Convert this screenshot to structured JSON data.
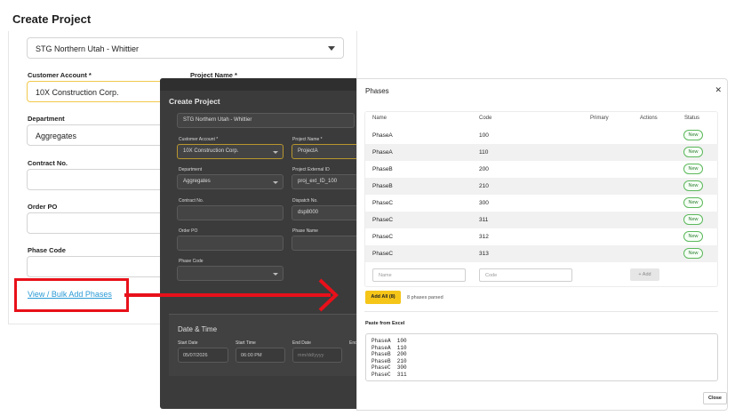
{
  "page_title": "Create Project",
  "form": {
    "company_value": "STG Northern Utah - Whittier",
    "customer_account_label": "Customer Account *",
    "customer_account_value": "10X Construction Corp.",
    "project_name_label": "Project Name *",
    "department_label": "Department",
    "department_value": "Aggregates",
    "contract_no_label": "Contract No.",
    "order_po_label": "Order PO",
    "phase_code_label": "Phase Code",
    "bulk_link": "View / Bulk Add Phases"
  },
  "overlay": {
    "title": "Create Project",
    "company_value": "STG Northern Utah - Whittier",
    "customer_account_label": "Customer Account *",
    "customer_account_value": "10X Construction Corp.",
    "project_name_label": "Project Name *",
    "project_name_value": "ProjectA",
    "department_label": "Department",
    "department_value": "Aggregates",
    "external_id_label": "Project External ID",
    "external_id_value": "proj_ext_ID_100",
    "contract_no_label": "Contract No.",
    "dispatch_no_label": "Dispatch No.",
    "dispatch_no_value": "dsp8000",
    "order_po_label": "Order PO",
    "phase_name_label": "Phase Name",
    "phase_code_label": "Phase Code",
    "date_time_title": "Date & Time",
    "start_date_label": "Start Date",
    "start_date_value": "05/07/2026",
    "start_time_label": "Start Time",
    "start_time_value": "06:00 PM",
    "end_date_label": "End Date",
    "end_date_placeholder": "mm/dd/yyyy",
    "end_label": "End"
  },
  "modal": {
    "title": "Phases",
    "close_icon": "close-icon",
    "columns": [
      "Name",
      "Code",
      "Primary",
      "Actions",
      "Status"
    ],
    "rows": [
      {
        "name": "PhaseA",
        "code": "100",
        "status": "New"
      },
      {
        "name": "PhaseA",
        "code": "110",
        "status": "New"
      },
      {
        "name": "PhaseB",
        "code": "200",
        "status": "New"
      },
      {
        "name": "PhaseB",
        "code": "210",
        "status": "New"
      },
      {
        "name": "PhaseC",
        "code": "300",
        "status": "New"
      },
      {
        "name": "PhaseC",
        "code": "311",
        "status": "New"
      },
      {
        "name": "PhaseC",
        "code": "312",
        "status": "New"
      },
      {
        "name": "PhaseC",
        "code": "313",
        "status": "New"
      }
    ],
    "name_placeholder": "Name",
    "code_placeholder": "Code",
    "add_button": "+ Add",
    "add_all_button": "Add All (8)",
    "parsed_text": "8 phases parsed",
    "paste_label": "Paste from Excel",
    "paste_lines": [
      "PhaseA  100",
      "PhaseA  110",
      "PhaseB  200",
      "PhaseB  210",
      "PhaseC  300",
      "PhaseC  311"
    ],
    "close_button": "Close"
  },
  "colors": {
    "accent_yellow": "#f5c518",
    "highlight_red": "#e8101a",
    "status_green": "#5cb85c",
    "link_blue": "#2a9ad6"
  }
}
